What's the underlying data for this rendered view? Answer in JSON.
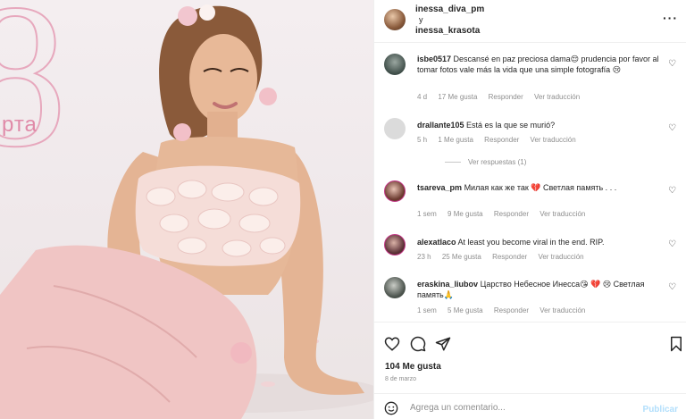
{
  "photo": {
    "date_word": "рта"
  },
  "post_header": {
    "account_1": "inessa_diva_pm",
    "conjunction": "y",
    "account_2": "inessa_krasota"
  },
  "comments": [
    {
      "username": "isbe0517",
      "text": "Descansé en paz preciosa dama😌 prudencia por favor al tomar fotos vale más la vida que una simple fotografía 😢",
      "time": "4 d",
      "likes": "17 Me gusta",
      "reply": "Responder",
      "translate": "Ver traducción"
    },
    {
      "username": "drallante105",
      "text": "Está es la que se murió?",
      "time": "5 h",
      "likes": "1 Me gusta",
      "reply": "Responder",
      "translate": "Ver traducción"
    },
    {
      "username": "tsareva_pm",
      "text": "Милая как же так 💔 Светлая память . . .",
      "time": "1 sem",
      "likes": "9 Me gusta",
      "reply": "Responder",
      "translate": "Ver traducción"
    },
    {
      "username": "alexatlaco",
      "text": "At least you become viral in the end. RIP.",
      "time": "23 h",
      "likes": "25 Me gusta",
      "reply": "Responder",
      "translate": "Ver traducción"
    },
    {
      "username": "eraskina_liubov",
      "text": "Царство Небесное Инесса😘 💔 😢 Светлая память🙏",
      "time": "1 sem",
      "likes": "5 Me gusta",
      "reply": "Responder",
      "translate": "Ver traducción"
    }
  ],
  "view_replies": "Ver respuestas (1)",
  "likes_count": "104 Me gusta",
  "post_date": "8 de marzo",
  "add_comment": {
    "placeholder": "Agrega un comentario...",
    "publish_label": "Publicar"
  },
  "colors": {
    "accent_disabled": "#b2dffc",
    "muted_text": "#8e8e8e"
  }
}
